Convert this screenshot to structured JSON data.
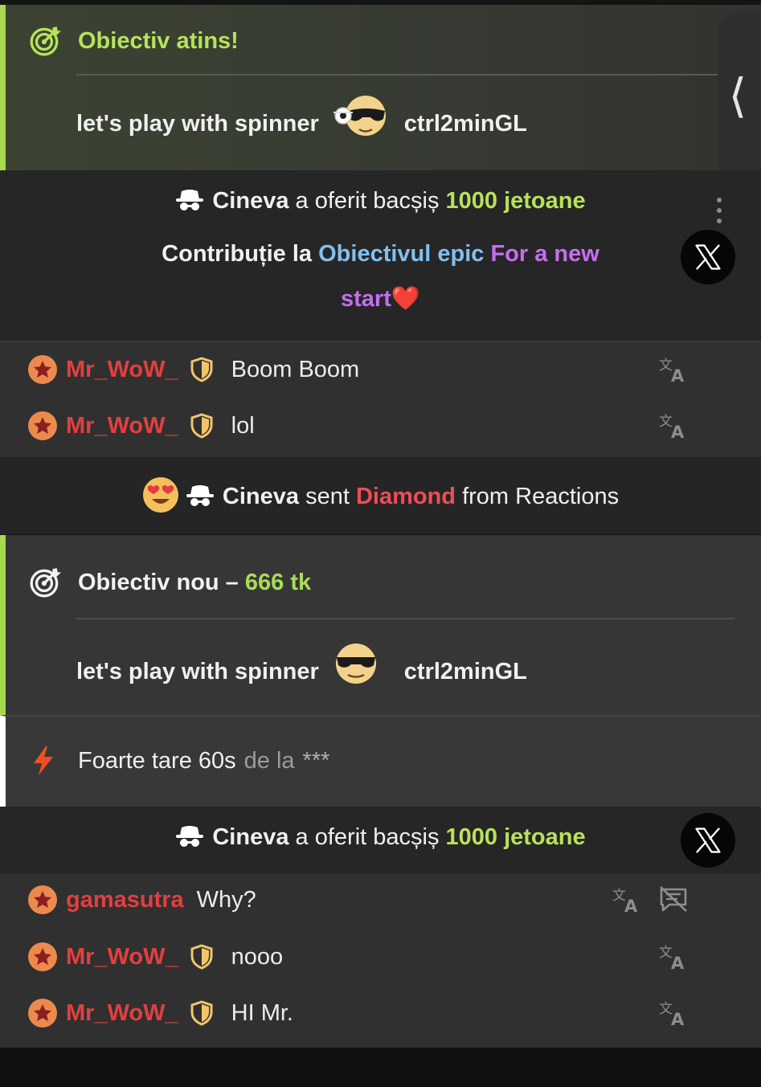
{
  "goal_achieved": {
    "title": "Obiectiv atins!",
    "item": "let's play with spinner",
    "username": "ctrl2minGL"
  },
  "tip_1": {
    "sender": "Cineva",
    "action": "a oferit bacșiș",
    "amount": "1000 jetoane",
    "contribution_prefix": "Contribuție la",
    "epic_label": "Obiectivul epic",
    "goal_name_a": "For a new",
    "goal_name_b": "start",
    "heart": "❤️"
  },
  "chat_1": [
    {
      "user": "Mr_WoW_",
      "text": "Boom Boom"
    },
    {
      "user": "Mr_WoW_",
      "text": "lol"
    }
  ],
  "gift": {
    "sender": "Cineva",
    "verb": "sent",
    "gift_name": "Diamond",
    "source": "from Reactions"
  },
  "goal_new": {
    "title": "Obiectiv nou –",
    "amount": "666 tk",
    "item": "let's play with spinner",
    "username": "ctrl2minGL"
  },
  "boost": {
    "text": "Foarte tare 60s",
    "by": "de la",
    "who": "***"
  },
  "tip_2": {
    "sender": "Cineva",
    "action": "a oferit bacșiș",
    "amount": "1000 jetoane"
  },
  "chat_2": [
    {
      "user": "gamasutra",
      "text": "Why?"
    },
    {
      "user": "Mr_WoW_",
      "text": "nooo"
    },
    {
      "user": "Mr_WoW_",
      "text": "HI Mr."
    }
  ],
  "colors": {
    "goal_green": "#b5e35a",
    "username_red": "#e33f3f",
    "epic_blue": "#83bfee",
    "goal_purple": "#c46ff0",
    "gift_red": "#ef4d56",
    "boost_orange": "#f04e23"
  }
}
